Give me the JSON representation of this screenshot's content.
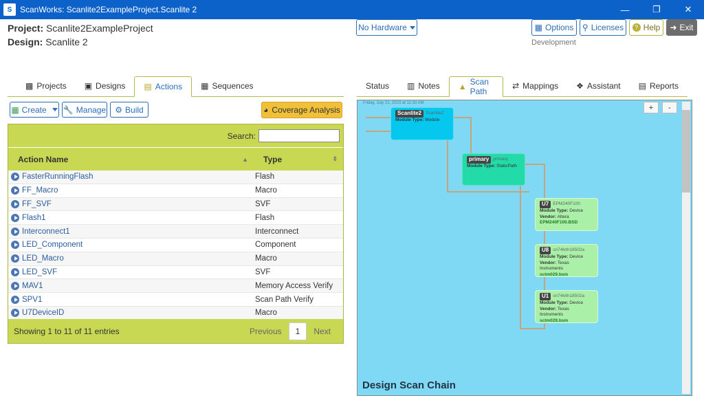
{
  "window": {
    "title": "ScanWorks: Scanlite2ExampleProject.Scanlite 2",
    "icon": "scanworks-icon"
  },
  "header": {
    "project_label": "Project:",
    "project_value": "Scanlite2ExampleProject",
    "design_label": "Design:",
    "design_value": "Scanlite 2",
    "hardware_button": "No Hardware",
    "options_label": "Options",
    "licenses_label": "Licenses",
    "help_label": "Help",
    "exit_label": "Exit",
    "environment": "Development"
  },
  "left_tabs": [
    {
      "label": "Projects",
      "icon": "briefcase-icon",
      "active": false
    },
    {
      "label": "Designs",
      "icon": "chip-icon",
      "active": false
    },
    {
      "label": "Actions",
      "icon": "actions-icon",
      "active": true
    },
    {
      "label": "Sequences",
      "icon": "sequences-icon",
      "active": false
    }
  ],
  "toolbar": {
    "create_label": "Create",
    "manage_label": "Manage",
    "build_label": "Build",
    "coverage_label": "Coverage Analysis"
  },
  "table": {
    "search_label": "Search:",
    "search_value": "",
    "columns": [
      "Action Name",
      "Type"
    ],
    "rows": [
      {
        "name": "FasterRunningFlash",
        "type": "Flash"
      },
      {
        "name": "FF_Macro",
        "type": "Macro"
      },
      {
        "name": "FF_SVF",
        "type": "SVF"
      },
      {
        "name": "Flash1",
        "type": "Flash"
      },
      {
        "name": "Interconnect1",
        "type": "Interconnect"
      },
      {
        "name": "LED_Component",
        "type": "Component"
      },
      {
        "name": "LED_Macro",
        "type": "Macro"
      },
      {
        "name": "LED_SVF",
        "type": "SVF"
      },
      {
        "name": "MAV1",
        "type": "Memory Access Verify"
      },
      {
        "name": "SPV1",
        "type": "Scan Path Verify"
      },
      {
        "name": "U7DeviceID",
        "type": "Macro"
      }
    ],
    "footer_text": "Showing 1 to 11 of 11 entries",
    "pager": {
      "previous": "Previous",
      "current": "1",
      "next": "Next"
    }
  },
  "right_tabs": [
    {
      "label": "Status",
      "icon": "",
      "active": false
    },
    {
      "label": "Notes",
      "icon": "notes-icon",
      "active": false
    },
    {
      "label": "Scan Path",
      "icon": "scanpath-icon",
      "active": true
    },
    {
      "label": "Mappings",
      "icon": "mappings-icon",
      "active": false
    },
    {
      "label": "Assistant",
      "icon": "assistant-icon",
      "active": false
    },
    {
      "label": "Reports",
      "icon": "reports-icon",
      "active": false
    }
  ],
  "scan_path": {
    "date": "Friday, July 21, 2023 at 11:30 AM",
    "zoom_in": "+",
    "zoom_out": "-",
    "title": "Design Scan Chain",
    "nodes": {
      "top": {
        "tag": "Scanlite2",
        "name": "Scanlite2",
        "type_label": "Module Type:",
        "type": "Module"
      },
      "primary": {
        "tag": "primary",
        "name": "primary",
        "type_label": "Module Type:",
        "type": "StaticPath"
      },
      "u7": {
        "tag": "U7",
        "name": "EPM240F100",
        "type_label": "Module Type:",
        "type": "Device",
        "vendor_label": "Vendor:",
        "vendor": "Altera",
        "file": "EPM240F100.BSD"
      },
      "u8": {
        "tag": "U8",
        "name": "sn74lvth18502a",
        "type_label": "Module Type:",
        "type": "Device",
        "vendor_label": "Vendor:",
        "vendor": "Texas Instruments",
        "file": "sctm029.bsm"
      },
      "u1": {
        "tag": "U1",
        "name": "sn74lvth18502a",
        "type_label": "Module Type:",
        "type": "Device",
        "vendor_label": "Vendor:",
        "vendor": "Texas Instruments",
        "file": "sctm029.bsm"
      }
    }
  }
}
